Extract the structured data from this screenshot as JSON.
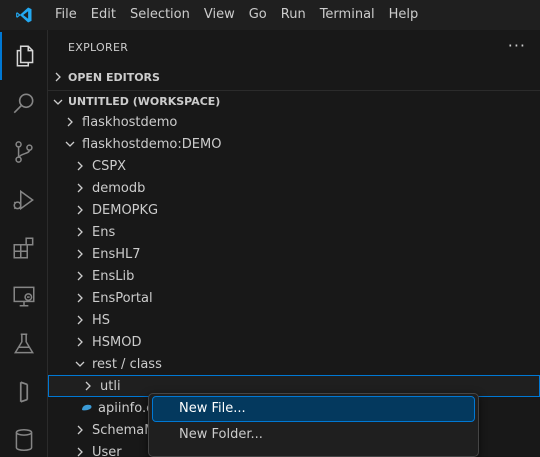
{
  "menubar": {
    "items": [
      "File",
      "Edit",
      "Selection",
      "View",
      "Go",
      "Run",
      "Terminal",
      "Help"
    ]
  },
  "activitybar": {
    "icons": [
      "explorer-icon",
      "search-icon",
      "source-control-icon",
      "run-debug-icon",
      "extensions-icon",
      "remote-explorer-icon",
      "testing-icon",
      "objectscript-icon",
      "database-icon"
    ]
  },
  "sidebar": {
    "title": "EXPLORER",
    "more": "···",
    "open_editors": "OPEN EDITORS",
    "workspace": "UNTITLED (WORKSPACE)"
  },
  "tree": [
    {
      "label": "flaskhostdemo",
      "expanded": false
    },
    {
      "label": "flaskhostdemo:DEMO",
      "expanded": true
    },
    {
      "label": "CSPX",
      "expanded": false
    },
    {
      "label": "demodb",
      "expanded": false
    },
    {
      "label": "DEMOPKG",
      "expanded": false
    },
    {
      "label": "Ens",
      "expanded": false
    },
    {
      "label": "EnsHL7",
      "expanded": false
    },
    {
      "label": "EnsLib",
      "expanded": false
    },
    {
      "label": "EnsPortal",
      "expanded": false
    },
    {
      "label": "HS",
      "expanded": false
    },
    {
      "label": "HSMOD",
      "expanded": false
    },
    {
      "label": "rest / class",
      "expanded": true
    },
    {
      "label": "utli",
      "expanded": false,
      "selected": true
    },
    {
      "label": "apiinfo.c",
      "file": true
    },
    {
      "label": "SchemaM",
      "expanded": false
    },
    {
      "label": "User",
      "expanded": false
    }
  ],
  "context_menu": {
    "items": [
      "New File...",
      "New Folder..."
    ]
  },
  "colors": {
    "accent": "#0078d4",
    "file_icon": "#3b9bd6"
  }
}
